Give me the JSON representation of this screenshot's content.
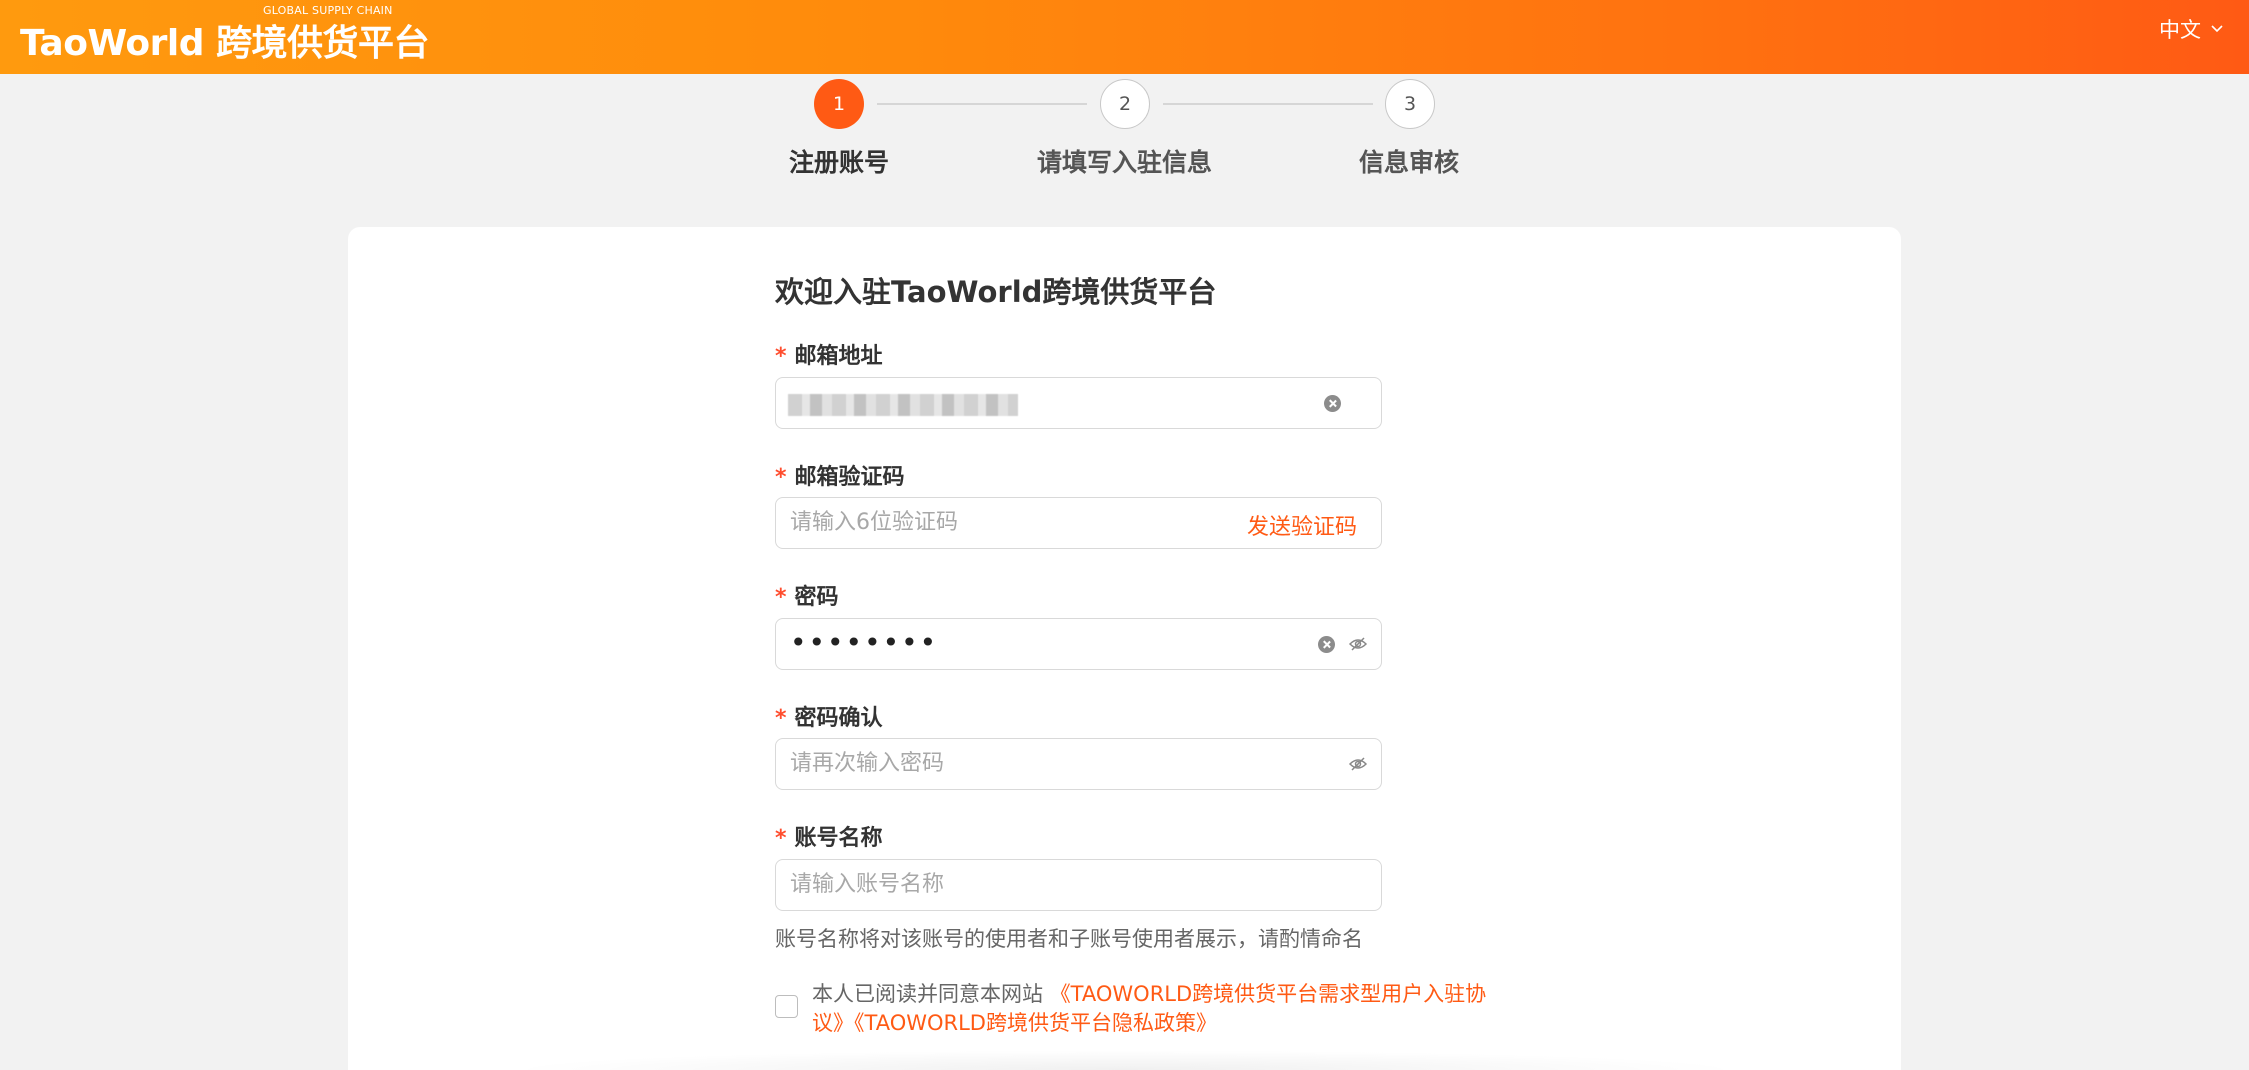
{
  "header": {
    "logo_main": "TaoWorld 跨境供货平台",
    "logo_sub": "GLOBAL SUPPLY CHAIN",
    "language": "中文"
  },
  "steps": [
    {
      "number": "1",
      "label": "注册账号",
      "state": "active"
    },
    {
      "number": "2",
      "label": "请填写入驻信息",
      "state": "inactive"
    },
    {
      "number": "3",
      "label": "信息审核",
      "state": "inactive"
    }
  ],
  "form": {
    "title": "欢迎入驻TaoWorld跨境供货平台",
    "required_mark": "*",
    "email": {
      "label": "邮箱地址",
      "value": ""
    },
    "code": {
      "label": "邮箱验证码",
      "placeholder": "请输入6位验证码",
      "send_label": "发送验证码"
    },
    "password": {
      "label": "密码",
      "masked_value": "••••••••"
    },
    "confirm": {
      "label": "密码确认",
      "placeholder": "请再次输入密码"
    },
    "account_name": {
      "label": "账号名称",
      "placeholder": "请输入账号名称",
      "hint": "账号名称将对该账号的使用者和子账号使用者展示，请酌情命名"
    },
    "agreement": {
      "prefix": "本人已阅读并同意本网站 ",
      "link1": "《TAOWORLD跨境供货平台需求型用户入驻协议》",
      "link2": "《TAOWORLD跨境供货平台隐私政策》",
      "checked": false
    }
  },
  "colors": {
    "accent": "#ff5a14",
    "header_start": "#ff9a0e",
    "header_end": "#ff5a14"
  }
}
